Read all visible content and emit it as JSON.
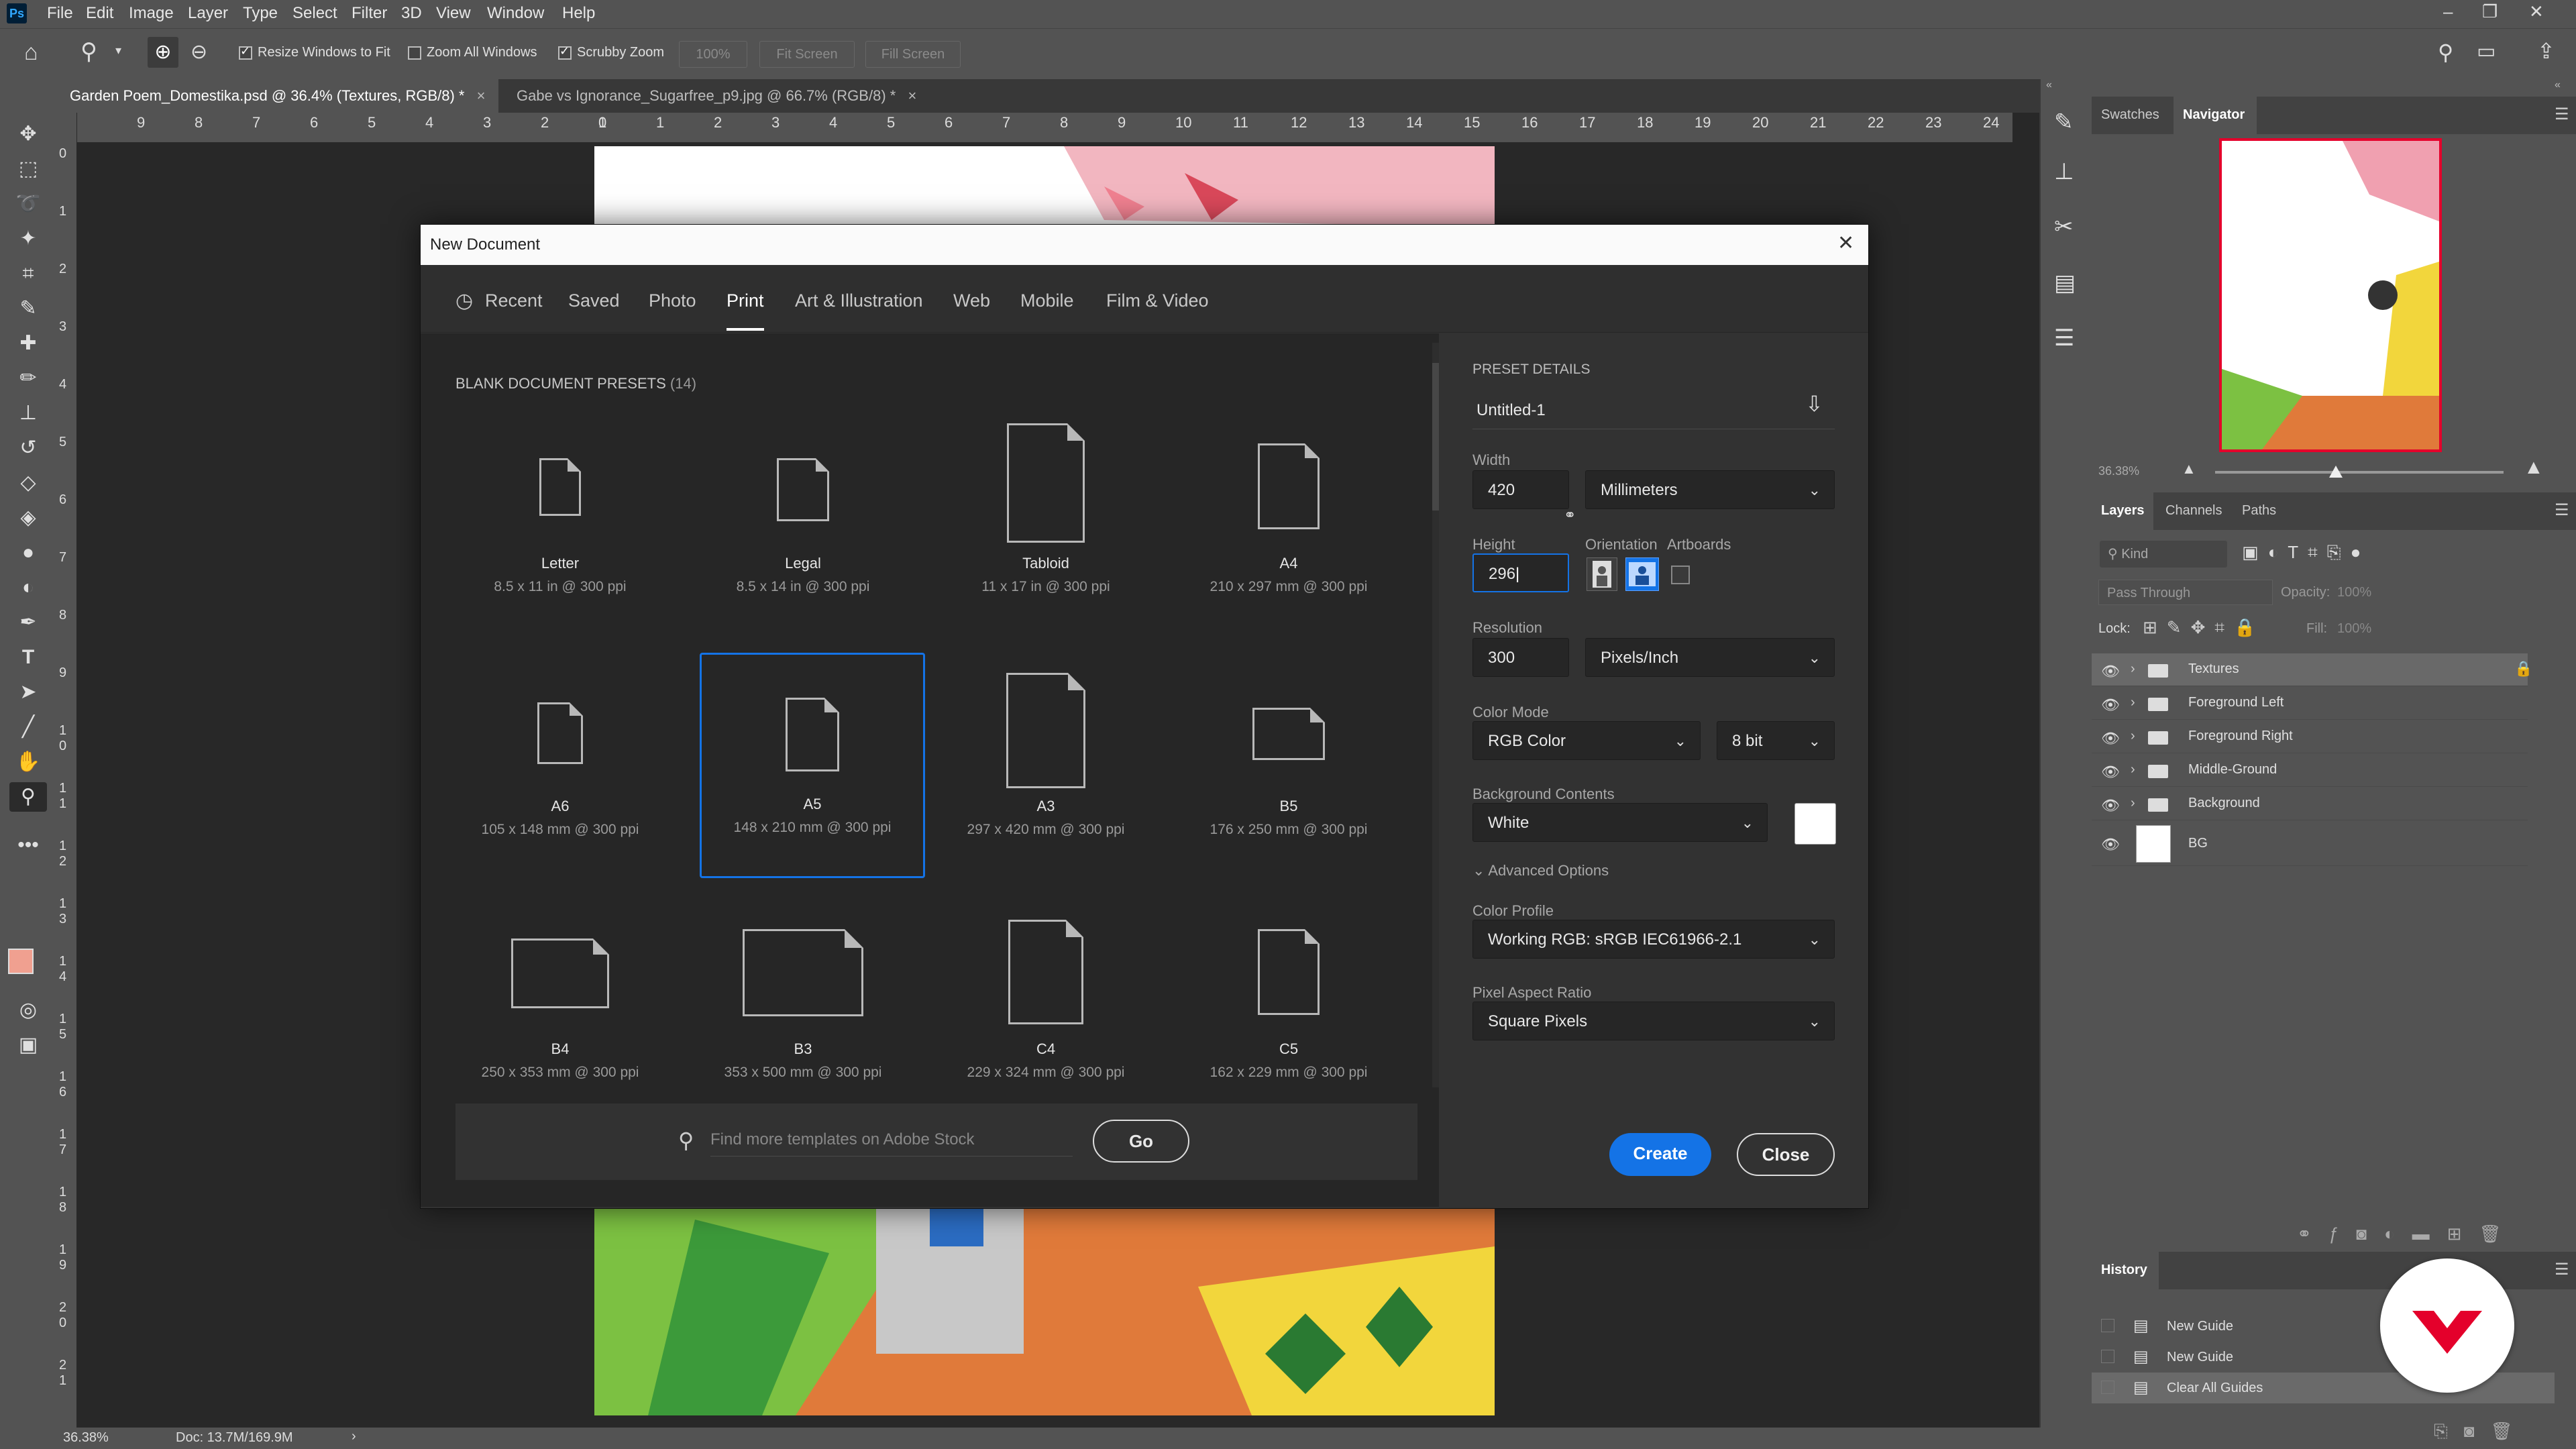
{
  "menubar": {
    "logo": "Ps",
    "items": [
      "File",
      "Edit",
      "Image",
      "Layer",
      "Type",
      "Select",
      "Filter",
      "3D",
      "View",
      "Window",
      "Help"
    ]
  },
  "optionsbar": {
    "resize_windows": "Resize Windows to Fit",
    "zoom_all": "Zoom All Windows",
    "scrubby_zoom": "Scrubby Zoom",
    "zoom_pct": "100%",
    "fit_screen": "Fit Screen",
    "fill_screen": "Fill Screen"
  },
  "doctabs": [
    {
      "label": "Garden Poem_Domestika.psd @ 36.4% (Textures, RGB/8) *",
      "close": "×"
    },
    {
      "label": "Gabe vs Ignorance_Sugarfree_p9.jpg @ 66.7% (RGB/8) *",
      "close": "×"
    }
  ],
  "ruler_top": [
    "9",
    "8",
    "7",
    "6",
    "5",
    "4",
    "3",
    "2",
    "1",
    "0",
    "1",
    "2",
    "3",
    "4",
    "5",
    "6",
    "7",
    "8",
    "9",
    "10",
    "11",
    "12",
    "13",
    "14",
    "15",
    "16",
    "17",
    "18",
    "19",
    "20",
    "21",
    "22",
    "23",
    "24"
  ],
  "ruler_left": [
    "0",
    "1",
    "2",
    "3",
    "4",
    "5",
    "6",
    "7",
    "8",
    "9",
    "1 0",
    "1 1",
    "1 2",
    "1 3",
    "1 4",
    "1 5",
    "1 6",
    "1 7",
    "1 8",
    "1 9",
    "2 0",
    "2 1"
  ],
  "statusbar": {
    "zoom": "36.38%",
    "doc": "Doc: 13.7M/169.9M",
    "arrow": "›"
  },
  "dialog": {
    "title": "New Document",
    "close": "✕",
    "tabs": [
      "Recent",
      "Saved",
      "Photo",
      "Print",
      "Art & Illustration",
      "Web",
      "Mobile",
      "Film & Video"
    ],
    "presets_heading": "BLANK DOCUMENT PRESETS",
    "presets_count": "(14)",
    "presets": [
      {
        "name": "Letter",
        "desc": "8.5 x 11 in @ 300 ppi"
      },
      {
        "name": "Legal",
        "desc": "8.5 x 14 in @ 300 ppi"
      },
      {
        "name": "Tabloid",
        "desc": "11 x 17 in @ 300 ppi"
      },
      {
        "name": "A4",
        "desc": "210 x 297 mm @ 300 ppi"
      },
      {
        "name": "A6",
        "desc": "105 x 148 mm @ 300 ppi"
      },
      {
        "name": "A5",
        "desc": "148 x 210 mm @ 300 ppi"
      },
      {
        "name": "A3",
        "desc": "297 x 420 mm @ 300 ppi"
      },
      {
        "name": "B5",
        "desc": "176 x 250 mm @ 300 ppi"
      },
      {
        "name": "B4",
        "desc": "250 x 353 mm @ 300 ppi"
      },
      {
        "name": "B3",
        "desc": "353 x 500 mm @ 300 ppi"
      },
      {
        "name": "C4",
        "desc": "229 x 324 mm @ 300 ppi"
      },
      {
        "name": "C5",
        "desc": "162 x 229 mm @ 300 ppi"
      }
    ],
    "search_placeholder": "Find more templates on Adobe Stock",
    "go": "Go",
    "details": {
      "heading": "PRESET DETAILS",
      "doc_name": "Untitled-1",
      "width_label": "Width",
      "width_value": "420",
      "width_unit": "Millimeters",
      "height_label": "Height",
      "height_value": "296",
      "orientation_label": "Orientation",
      "artboards_label": "Artboards",
      "resolution_label": "Resolution",
      "resolution_value": "300",
      "resolution_unit": "Pixels/Inch",
      "color_mode_label": "Color Mode",
      "color_mode": "RGB Color",
      "bit_depth": "8 bit",
      "bg_label": "Background Contents",
      "bg_value": "White",
      "advanced": "Advanced Options",
      "profile_label": "Color Profile",
      "profile_value": "Working RGB: sRGB IEC61966-2.1",
      "par_label": "Pixel Aspect Ratio",
      "par_value": "Square Pixels",
      "create": "Create",
      "close": "Close"
    }
  },
  "panels": {
    "top_tabs": [
      "Swatches",
      "Navigator"
    ],
    "nav_zoom": "36.38%",
    "layer_tabs": [
      "Layers",
      "Channels",
      "Paths"
    ],
    "kind": "Kind",
    "blend": "Pass Through",
    "opacity_label": "Opacity:",
    "opacity_value": "100%",
    "lock_label": "Lock:",
    "fill_label": "Fill:",
    "fill_value": "100%",
    "layers": [
      "Textures",
      "Foreground Left",
      "Foreground Right",
      "Middle-Ground",
      "Background",
      "BG"
    ],
    "history_title": "History",
    "history": [
      "New Guide",
      "New Guide",
      "Clear All Guides"
    ]
  },
  "colors": {
    "accent": "#1473e6",
    "brand_red": "#e4002b",
    "foreground_swatch": "#f0a090"
  }
}
